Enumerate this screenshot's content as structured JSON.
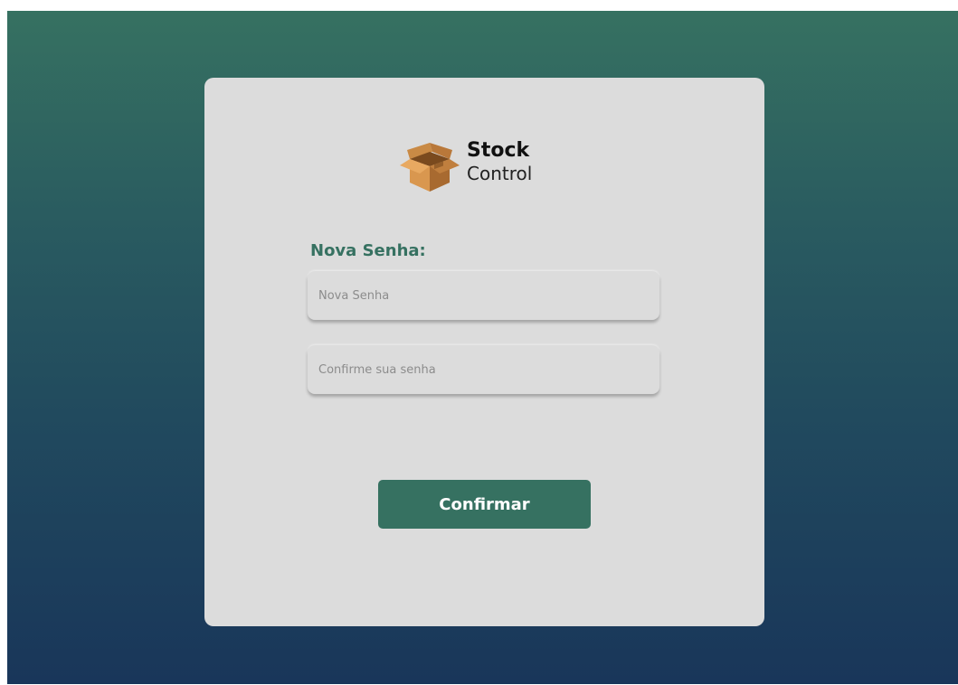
{
  "logo": {
    "line1": "Stock",
    "line2": "Control",
    "icon": "cardboard-box-icon"
  },
  "form": {
    "label": "Nova Senha:",
    "new_password_placeholder": "Nova Senha",
    "confirm_password_placeholder": "Confirme sua senha",
    "submit_label": "Confirmar"
  },
  "colors": {
    "accent": "#367161",
    "card_background": "#dcdcdc",
    "background_top": "#367161",
    "background_bottom": "#19365a"
  }
}
